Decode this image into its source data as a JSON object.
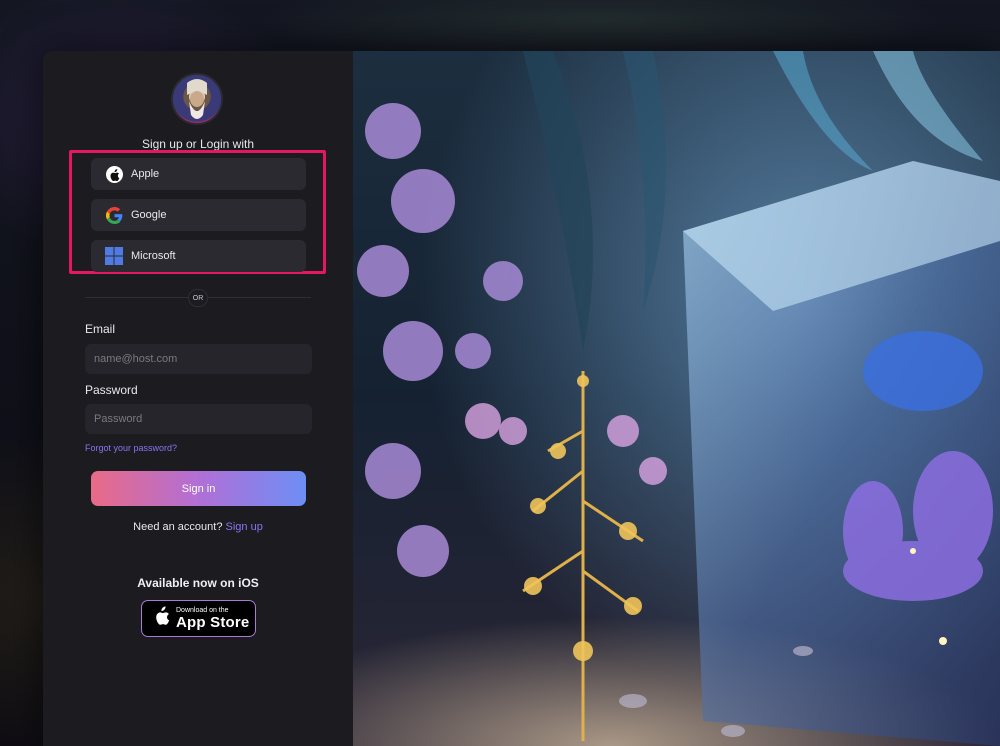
{
  "auth": {
    "heading": "Sign up or Login with",
    "providers": [
      {
        "label": "Apple",
        "icon": "apple-icon"
      },
      {
        "label": "Google",
        "icon": "google-icon"
      },
      {
        "label": "Microsoft",
        "icon": "microsoft-icon"
      }
    ],
    "divider": "OR",
    "email": {
      "label": "Email",
      "placeholder": "name@host.com",
      "value": ""
    },
    "password": {
      "label": "Password",
      "placeholder": "Password",
      "value": ""
    },
    "forgot": "Forgot your password?",
    "signin": "Sign in",
    "need_account": "Need an account?",
    "signup": "Sign up"
  },
  "promo": {
    "ios_text": "Available now on iOS",
    "store_small": "Download on the",
    "store_big": "App Store"
  },
  "colors": {
    "highlight": "#e5175e",
    "link": "#8a74f2",
    "gradient_start": "#e96a86",
    "gradient_end": "#6d8ef5"
  }
}
